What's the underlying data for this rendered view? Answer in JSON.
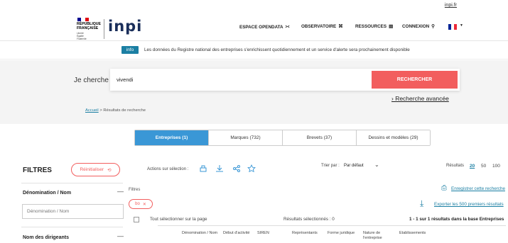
{
  "topbar": {
    "link": "inpi.fr"
  },
  "header": {
    "gov_line1": "RÉPUBLIQUE",
    "gov_line2": "FRANÇAISE",
    "gov_motto": "Liberté Égalité Fraternité",
    "logo": "inpi",
    "nav": [
      {
        "label": "ESPACE OPENDATA",
        "icon": "share-icon",
        "glyph": "⪥"
      },
      {
        "label": "OBSERVATOIRE",
        "icon": "binoculars-icon",
        "glyph": "⌘"
      },
      {
        "label": "RESSOURCES",
        "icon": "document-icon",
        "glyph": "▤"
      },
      {
        "label": "CONNEXION",
        "icon": "user-icon",
        "glyph": "⚲"
      }
    ]
  },
  "info": {
    "badge": "info",
    "text": "Les données du Registre national des entreprises s'enrichissent quotidiennement et un service d'alerte sera prochainement disponible"
  },
  "search": {
    "label": "Je cherche",
    "value": "vivendi",
    "button": "RECHERCHER",
    "advanced": "› Recherche avancée"
  },
  "breadcrumb": {
    "home": "Accueil",
    "sep": ">",
    "current": "Résultats de recherche"
  },
  "tabs": [
    {
      "label": "Entreprises (1)",
      "active": true
    },
    {
      "label": "Marques (732)",
      "active": false
    },
    {
      "label": "Brevets (37)",
      "active": false
    },
    {
      "label": "Dessins et modèles (29)",
      "active": false
    }
  ],
  "filters": {
    "title": "FILTRES",
    "reset": "Réinitialiser",
    "denomination_heading": "Dénomination / Nom",
    "denomination_placeholder": "Dénomination / Nom",
    "dirigeants_heading": "Nom des dirigeants"
  },
  "toolbar": {
    "actions_label": "Actions sur sélection :",
    "sort_label": "Trier par :",
    "sort_value": "Par défaut",
    "results_label": "Résultats",
    "page_sizes": [
      "20",
      "50",
      "100"
    ],
    "selected_page_size": "20"
  },
  "results": {
    "filters_label": "Filtres",
    "chip": "bo",
    "save_search": "Enregistrer cette recherche",
    "export": "Exporter les 500 premiers résultats",
    "select_all": "Tout sélectionner sur la page",
    "selected_count": "Résultats sélectionnés : 0",
    "count_text": "1 - 1 sur 1 résultats dans la base Entreprises",
    "columns": [
      "Dénomination / Nom",
      "Début d'activité",
      "SIREN",
      "Représentants",
      "Forme juridique",
      "Nature de l'entreprise",
      "Etablissements"
    ]
  },
  "colors": {
    "accent": "#1b7fa3",
    "button_red": "#f25e5e",
    "tab_active": "#3a97d6",
    "logo": "#1a2e5a"
  }
}
